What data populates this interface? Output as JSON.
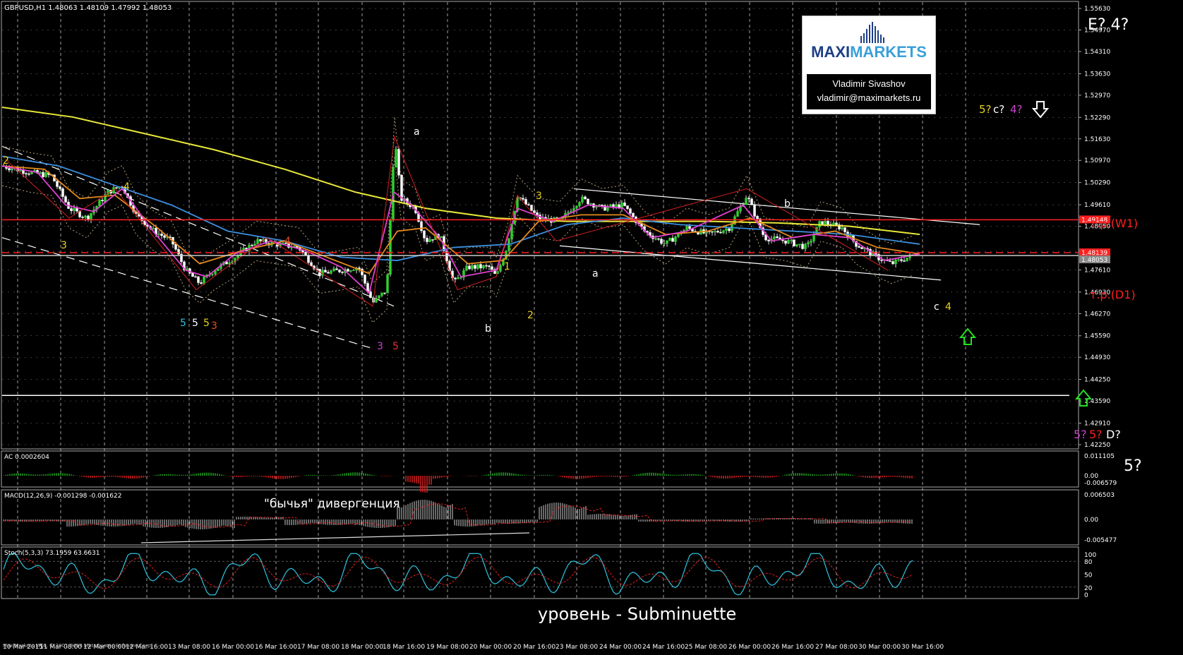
{
  "header": {
    "symbol": "GBPUSD,H1",
    "ohlc": "1.48063 1.48109 1.47992 1.48053"
  },
  "logo": {
    "brand_a": "MAXI",
    "brand_b": "MARKETS",
    "author": "Vladimir Sivashov",
    "email": "vladimir@maximarkets.ru"
  },
  "colors": {
    "background": "#000000",
    "grid": "#c8c8c8",
    "ma_long": "#e8e83a",
    "ma_mid": "#3b8fe0",
    "ma_fast": "#e58a1c",
    "ma_fastest": "#e040d0",
    "level_red": "#ff1f1f",
    "up_arrow": "#22e022",
    "ac_up": "#1fa81f",
    "ac_down": "#d81f1f"
  },
  "annotations": {
    "e4": "E? 4?",
    "c_top": "5? c? 4?",
    "c_top_parts": [
      "5?",
      "c?",
      "4?"
    ],
    "tr_w1": "т.р.(W1)",
    "tr_d1": "т.р.(D1)",
    "d_parts": [
      "5?",
      "5?",
      "D?"
    ],
    "five": "5?",
    "bull_div": "\"бычья\" дивергенция",
    "level": "уровень - Subminuette"
  },
  "wave_labels": [
    {
      "t": "a",
      "c": "#ffffff"
    },
    {
      "t": "b",
      "c": "#ffffff"
    },
    {
      "t": "a",
      "c": "#ffffff"
    },
    {
      "t": "b",
      "c": "#ffffff"
    },
    {
      "t": "c",
      "c": "#ffffff"
    },
    {
      "t": "4",
      "c": "#e8d21c"
    },
    {
      "t": "3",
      "c": "#e8d21c"
    },
    {
      "t": "4",
      "c": "#e8d21c"
    },
    {
      "t": "5",
      "c": "#2ec4e0"
    },
    {
      "t": "5",
      "c": "#ffffff"
    },
    {
      "t": "5",
      "c": "#e8d21c"
    },
    {
      "t": "3",
      "c": "#e85020"
    },
    {
      "t": "4",
      "c": "#e85020"
    },
    {
      "t": "3",
      "c": "#d040d0"
    },
    {
      "t": "5",
      "c": "#e83030"
    },
    {
      "t": "3",
      "c": "#e8d21c"
    },
    {
      "t": "1",
      "c": "#e8d21c"
    },
    {
      "t": "2",
      "c": "#e8d21c"
    },
    {
      "t": "2",
      "c": "#e8d21c"
    }
  ],
  "chart_data": {
    "type": "candlestick",
    "price_axis": {
      "ticks": [
        "1.55630",
        "1.54970",
        "1.54310",
        "1.53630",
        "1.52970",
        "1.52290",
        "1.51630",
        "1.50970",
        "1.50290",
        "1.49610",
        "1.48950",
        "1.48180",
        "1.47610",
        "1.46930",
        "1.46270",
        "1.45590",
        "1.44930",
        "1.44250",
        "1.43590",
        "1.42910",
        "1.42250"
      ],
      "ylim": [
        1.4225,
        1.5563
      ],
      "current": "1.48053",
      "level_labels": [
        "1.49148",
        "1.48139"
      ]
    },
    "time_axis": {
      "ticks": [
        "10 Mar 2015",
        "11 Mar 08:00",
        "12 Mar 00:00",
        "12 Mar 16:00",
        "13 Mar 08:00",
        "16 Mar 00:00",
        "16 Mar 16:00",
        "17 Mar 08:00",
        "18 Mar 00:00",
        "18 Mar 16:00",
        "19 Mar 08:00",
        "20 Mar 00:00",
        "20 Mar 16:00",
        "23 Mar 08:00",
        "24 Mar 00:00",
        "24 Mar 16:00",
        "25 Mar 08:00",
        "26 Mar 00:00",
        "26 Mar 16:00",
        "27 Mar 08:00",
        "30 Mar 00:00",
        "30 Mar 16:00"
      ]
    },
    "levels": [
      {
        "name": "т.р.(W1)",
        "price": 1.49148,
        "color": "#ff1f1f",
        "style": "solid"
      },
      {
        "name": "т.р.(D1)",
        "price": 1.48139,
        "color": "#ff1f1f",
        "style": "dashed"
      },
      {
        "name": "current",
        "price": 1.48053,
        "color": "#cccccc",
        "style": "solid"
      },
      {
        "name": "support",
        "price": 1.4376,
        "color": "#ffffff",
        "style": "solid"
      }
    ],
    "price_path": [
      [
        0,
        1.508
      ],
      [
        40,
        1.506
      ],
      [
        70,
        1.505
      ],
      [
        95,
        1.495
      ],
      [
        120,
        1.492
      ],
      [
        150,
        1.5
      ],
      [
        170,
        1.502
      ],
      [
        190,
        1.493
      ],
      [
        215,
        1.488
      ],
      [
        240,
        1.485
      ],
      [
        260,
        1.476
      ],
      [
        280,
        1.472
      ],
      [
        300,
        1.476
      ],
      [
        330,
        1.48
      ],
      [
        360,
        1.485
      ],
      [
        390,
        1.484
      ],
      [
        420,
        1.483
      ],
      [
        450,
        1.475
      ],
      [
        480,
        1.476
      ],
      [
        505,
        1.477
      ],
      [
        525,
        1.466
      ],
      [
        545,
        1.47
      ],
      [
        556,
        1.517
      ],
      [
        565,
        1.498
      ],
      [
        585,
        1.495
      ],
      [
        600,
        1.485
      ],
      [
        620,
        1.487
      ],
      [
        640,
        1.472
      ],
      [
        660,
        1.477
      ],
      [
        690,
        1.477
      ],
      [
        700,
        1.474
      ],
      [
        715,
        1.483
      ],
      [
        730,
        1.499
      ],
      [
        760,
        1.492
      ],
      [
        790,
        1.491
      ],
      [
        820,
        1.498
      ],
      [
        850,
        1.495
      ],
      [
        880,
        1.496
      ],
      [
        910,
        1.488
      ],
      [
        940,
        1.484
      ],
      [
        970,
        1.489
      ],
      [
        1000,
        1.487
      ],
      [
        1030,
        1.489
      ],
      [
        1055,
        1.499
      ],
      [
        1080,
        1.486
      ],
      [
        1110,
        1.485
      ],
      [
        1140,
        1.483
      ],
      [
        1160,
        1.491
      ],
      [
        1190,
        1.489
      ],
      [
        1210,
        1.484
      ],
      [
        1240,
        1.48
      ],
      [
        1260,
        1.478
      ],
      [
        1290,
        1.4805
      ]
    ],
    "series": [
      {
        "name": "",
        "color": "#e8e83a",
        "values": [
          [
            0,
            1.526
          ],
          [
            100,
            1.523
          ],
          [
            200,
            1.518
          ],
          [
            300,
            1.513
          ],
          [
            400,
            1.507
          ],
          [
            500,
            1.5
          ],
          [
            600,
            1.495
          ],
          [
            700,
            1.492
          ],
          [
            800,
            1.491
          ],
          [
            900,
            1.491
          ],
          [
            1000,
            1.491
          ],
          [
            1100,
            1.4905
          ],
          [
            1200,
            1.4895
          ],
          [
            1300,
            1.487
          ]
        ]
      },
      {
        "name": "",
        "color": "#3b8fe0",
        "values": [
          [
            0,
            1.511
          ],
          [
            80,
            1.508
          ],
          [
            160,
            1.502
          ],
          [
            240,
            1.496
          ],
          [
            320,
            1.488
          ],
          [
            400,
            1.485
          ],
          [
            480,
            1.48
          ],
          [
            560,
            1.479
          ],
          [
            640,
            1.483
          ],
          [
            720,
            1.484
          ],
          [
            800,
            1.49
          ],
          [
            880,
            1.492
          ],
          [
            960,
            1.49
          ],
          [
            1040,
            1.489
          ],
          [
            1120,
            1.488
          ],
          [
            1200,
            1.487
          ],
          [
            1300,
            1.484
          ]
        ]
      },
      {
        "name": "",
        "color": "#e58a1c",
        "values": [
          [
            0,
            1.508
          ],
          [
            60,
            1.507
          ],
          [
            110,
            1.498
          ],
          [
            160,
            1.499
          ],
          [
            220,
            1.489
          ],
          [
            280,
            1.478
          ],
          [
            340,
            1.482
          ],
          [
            400,
            1.485
          ],
          [
            460,
            1.48
          ],
          [
            520,
            1.475
          ],
          [
            560,
            1.488
          ],
          [
            600,
            1.489
          ],
          [
            660,
            1.478
          ],
          [
            710,
            1.479
          ],
          [
            760,
            1.491
          ],
          [
            820,
            1.493
          ],
          [
            880,
            1.493
          ],
          [
            940,
            1.487
          ],
          [
            1000,
            1.488
          ],
          [
            1060,
            1.492
          ],
          [
            1120,
            1.486
          ],
          [
            1180,
            1.488
          ],
          [
            1240,
            1.483
          ],
          [
            1300,
            1.481
          ]
        ]
      },
      {
        "name": "",
        "color": "#e040d0",
        "values": [
          [
            0,
            1.508
          ],
          [
            50,
            1.506
          ],
          [
            90,
            1.496
          ],
          [
            130,
            1.494
          ],
          [
            170,
            1.501
          ],
          [
            210,
            1.489
          ],
          [
            260,
            1.476
          ],
          [
            290,
            1.474
          ],
          [
            330,
            1.481
          ],
          [
            380,
            1.485
          ],
          [
            430,
            1.482
          ],
          [
            480,
            1.477
          ],
          [
            520,
            1.469
          ],
          [
            555,
            1.5
          ],
          [
            580,
            1.496
          ],
          [
            620,
            1.486
          ],
          [
            650,
            1.474
          ],
          [
            700,
            1.476
          ],
          [
            730,
            1.495
          ],
          [
            780,
            1.491
          ],
          [
            830,
            1.496
          ],
          [
            880,
            1.495
          ],
          [
            920,
            1.486
          ],
          [
            970,
            1.488
          ],
          [
            1050,
            1.496
          ],
          [
            1090,
            1.485
          ],
          [
            1150,
            1.487
          ],
          [
            1200,
            1.486
          ],
          [
            1250,
            1.479
          ],
          [
            1300,
            1.481
          ]
        ]
      }
    ],
    "channels": [
      {
        "color": "#ffffff",
        "dash": true,
        "from": [
          0,
          1.514
        ],
        "to": [
          555,
          1.465
        ]
      },
      {
        "color": "#ffffff",
        "dash": true,
        "from": [
          0,
          1.486
        ],
        "to": [
          525,
          1.452
        ]
      },
      {
        "color": "#ffffff",
        "dash": false,
        "from": [
          810,
          1.501
        ],
        "to": [
          1385,
          1.49
        ]
      },
      {
        "color": "#ffffff",
        "dash": false,
        "from": [
          790,
          1.4835
        ],
        "to": [
          1330,
          1.473
        ]
      }
    ],
    "wave_path": [
      [
        5,
        1.51
      ],
      [
        95,
        1.492
      ],
      [
        160,
        1.501
      ],
      [
        275,
        1.47
      ],
      [
        375,
        1.486
      ],
      [
        525,
        1.465
      ],
      [
        556,
        1.517
      ],
      [
        645,
        1.47
      ],
      [
        700,
        1.474
      ],
      [
        730,
        1.499
      ],
      [
        785,
        1.485
      ],
      [
        1055,
        1.501
      ],
      [
        1255,
        1.476
      ]
    ],
    "ac": {
      "label": "AC 0.0002604",
      "ticks": [
        "0.011105",
        "0.00",
        "-0.006579"
      ],
      "ylim": [
        -0.006579,
        0.011105
      ]
    },
    "macd": {
      "label": "MACD(12,26,9) -0.001298 -0.001622",
      "ticks": [
        "0.006503",
        "0.00",
        "-0.005477"
      ],
      "ylim": [
        -0.005477,
        0.006503
      ]
    },
    "stoch": {
      "label": "Stoch(5,3,3) 73.1959 63.6631",
      "ticks": [
        "100",
        "80",
        "50",
        "20",
        "0"
      ],
      "ylim": [
        0,
        100
      ]
    }
  },
  "footer": {
    "copyright": "MaxiMarkets MT4, © 2001-2014 MetaQuotes Software Corp."
  }
}
